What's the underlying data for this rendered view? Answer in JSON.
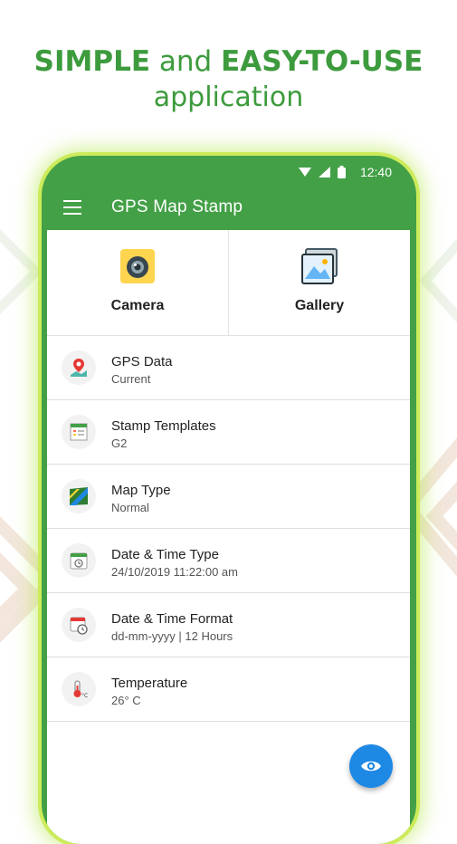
{
  "headline": {
    "word1": "SIMPLE",
    "word2": "and",
    "word3": "EASY-TO-USE",
    "line2": "application"
  },
  "status_bar": {
    "time": "12:40",
    "icons": [
      "wifi-icon",
      "signal-icon",
      "battery-icon"
    ]
  },
  "toolbar": {
    "title": "GPS Map Stamp",
    "menu_icon": "hamburger-menu-icon"
  },
  "actions": [
    {
      "label": "Camera",
      "icon": "camera-icon"
    },
    {
      "label": "Gallery",
      "icon": "gallery-icon"
    }
  ],
  "settings": [
    {
      "title": "GPS Data",
      "value": "Current",
      "icon": "map-pin-icon"
    },
    {
      "title": "Stamp Templates",
      "value": "G2",
      "icon": "template-icon"
    },
    {
      "title": "Map Type",
      "value": "Normal",
      "icon": "map-icon"
    },
    {
      "title": "Date & Time Type",
      "value": "24/10/2019 11:22:00 am",
      "icon": "calendar-clock-icon"
    },
    {
      "title": "Date & Time Format",
      "value": "dd-mm-yyyy | 12 Hours",
      "icon": "calendar-format-icon"
    },
    {
      "title": "Temperature",
      "value": "26° C",
      "icon": "thermometer-icon"
    }
  ],
  "fab": {
    "icon": "eye-icon"
  },
  "colors": {
    "primary": "#43a047",
    "headline": "#3d9b3d",
    "phone_glow": "#cdeb5a",
    "fab": "#1e88e5"
  }
}
